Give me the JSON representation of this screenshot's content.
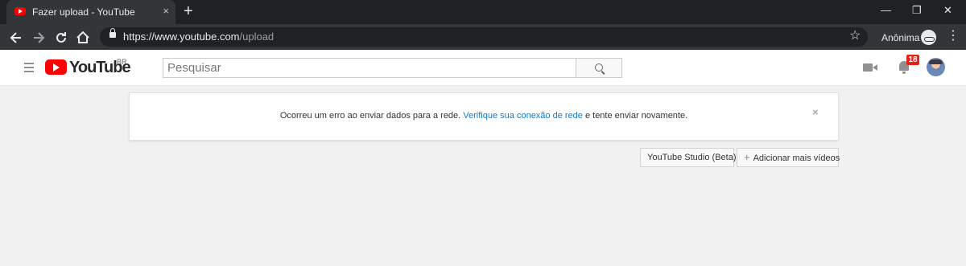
{
  "browser": {
    "tab_title": "Fazer upload - YouTube",
    "tab_close": "×",
    "new_tab": "+",
    "url_host": "https://www.youtube.com",
    "url_path": "/upload",
    "profile_label": "Anônima",
    "window_controls": {
      "minimize": "—",
      "restore": "❐",
      "close": "✕"
    },
    "nav_icons": {
      "back": "arrow-left-icon",
      "forward": "arrow-right-icon",
      "reload": "reload-icon",
      "home": "home-icon"
    }
  },
  "header": {
    "logo_text": "YouTube",
    "country_code": "BR",
    "search_placeholder": "Pesquisar",
    "notification_count": "18"
  },
  "alert": {
    "message_before": "Ocorreu um erro ao enviar dados para a rede. ",
    "link_text": "Verifique sua conexão de rede",
    "message_after": " e tente enviar novamente.",
    "close": "×"
  },
  "actions": {
    "studio_label": "YouTube Studio (Beta)",
    "add_videos_label": "Adicionar mais vídeos"
  },
  "colors": {
    "brand": "#ff0000",
    "link": "#167ac6",
    "badge": "#e62117",
    "page_bg": "#f1f1f1"
  }
}
